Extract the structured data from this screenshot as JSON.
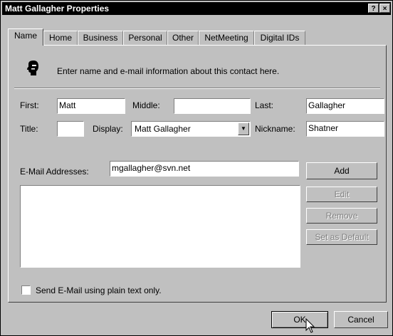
{
  "window": {
    "title": "Matt Gallagher Properties",
    "help_glyph": "?",
    "close_glyph": "×"
  },
  "tabs": [
    "Name",
    "Home",
    "Business",
    "Personal",
    "Other",
    "NetMeeting",
    "Digital IDs"
  ],
  "intro": {
    "text": "Enter name and e-mail information about this contact here."
  },
  "fields": {
    "first_label": "First:",
    "first_value": "Matt",
    "middle_label": "Middle:",
    "middle_value": "",
    "last_label": "Last:",
    "last_value": "Gallagher",
    "title_label": "Title:",
    "title_value": "",
    "display_label": "Display:",
    "display_value": "Matt Gallagher",
    "nickname_label": "Nickname:",
    "nickname_value": "Shatner"
  },
  "email": {
    "label": "E-Mail Addresses:",
    "value": "mgallagher@svn.net",
    "addresses": []
  },
  "buttons": {
    "add": "Add",
    "edit": "Edit",
    "remove": "Remove",
    "set_default": "Set as Default",
    "ok": "OK",
    "cancel": "Cancel"
  },
  "plain_text": {
    "label": "Send E-Mail using plain text only.",
    "checked": false
  }
}
